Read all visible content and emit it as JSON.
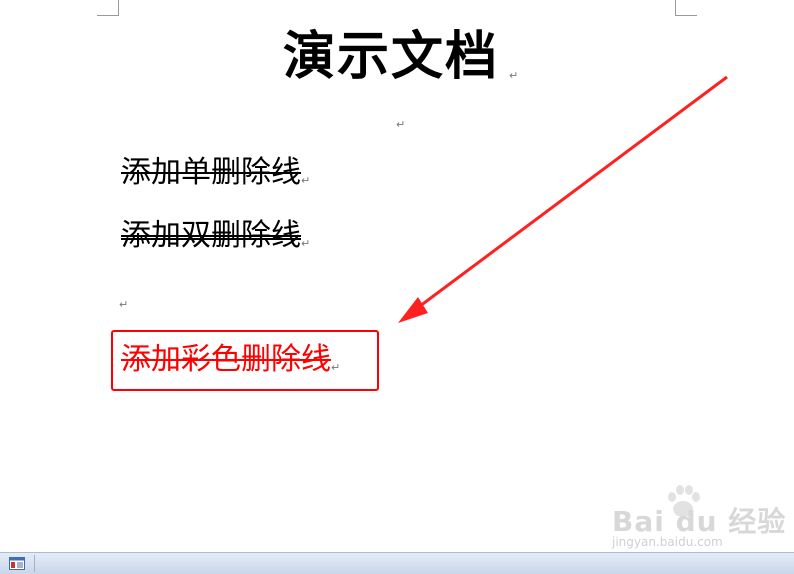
{
  "document": {
    "title": "演示文档",
    "paragraph_mark": "↵",
    "lines": [
      {
        "text": "添加单删除线",
        "strike": "single"
      },
      {
        "text": "添加双删除线",
        "strike": "double"
      },
      {
        "text": "添加彩色删除线",
        "strike": "colored"
      }
    ]
  },
  "colors": {
    "highlight": "#ff0000",
    "text": "#000000"
  },
  "watermark": {
    "brand": "Bai du 经验",
    "url": "jingyan.baidu.com"
  },
  "statusbar": {
    "icon": "layout-icon"
  }
}
